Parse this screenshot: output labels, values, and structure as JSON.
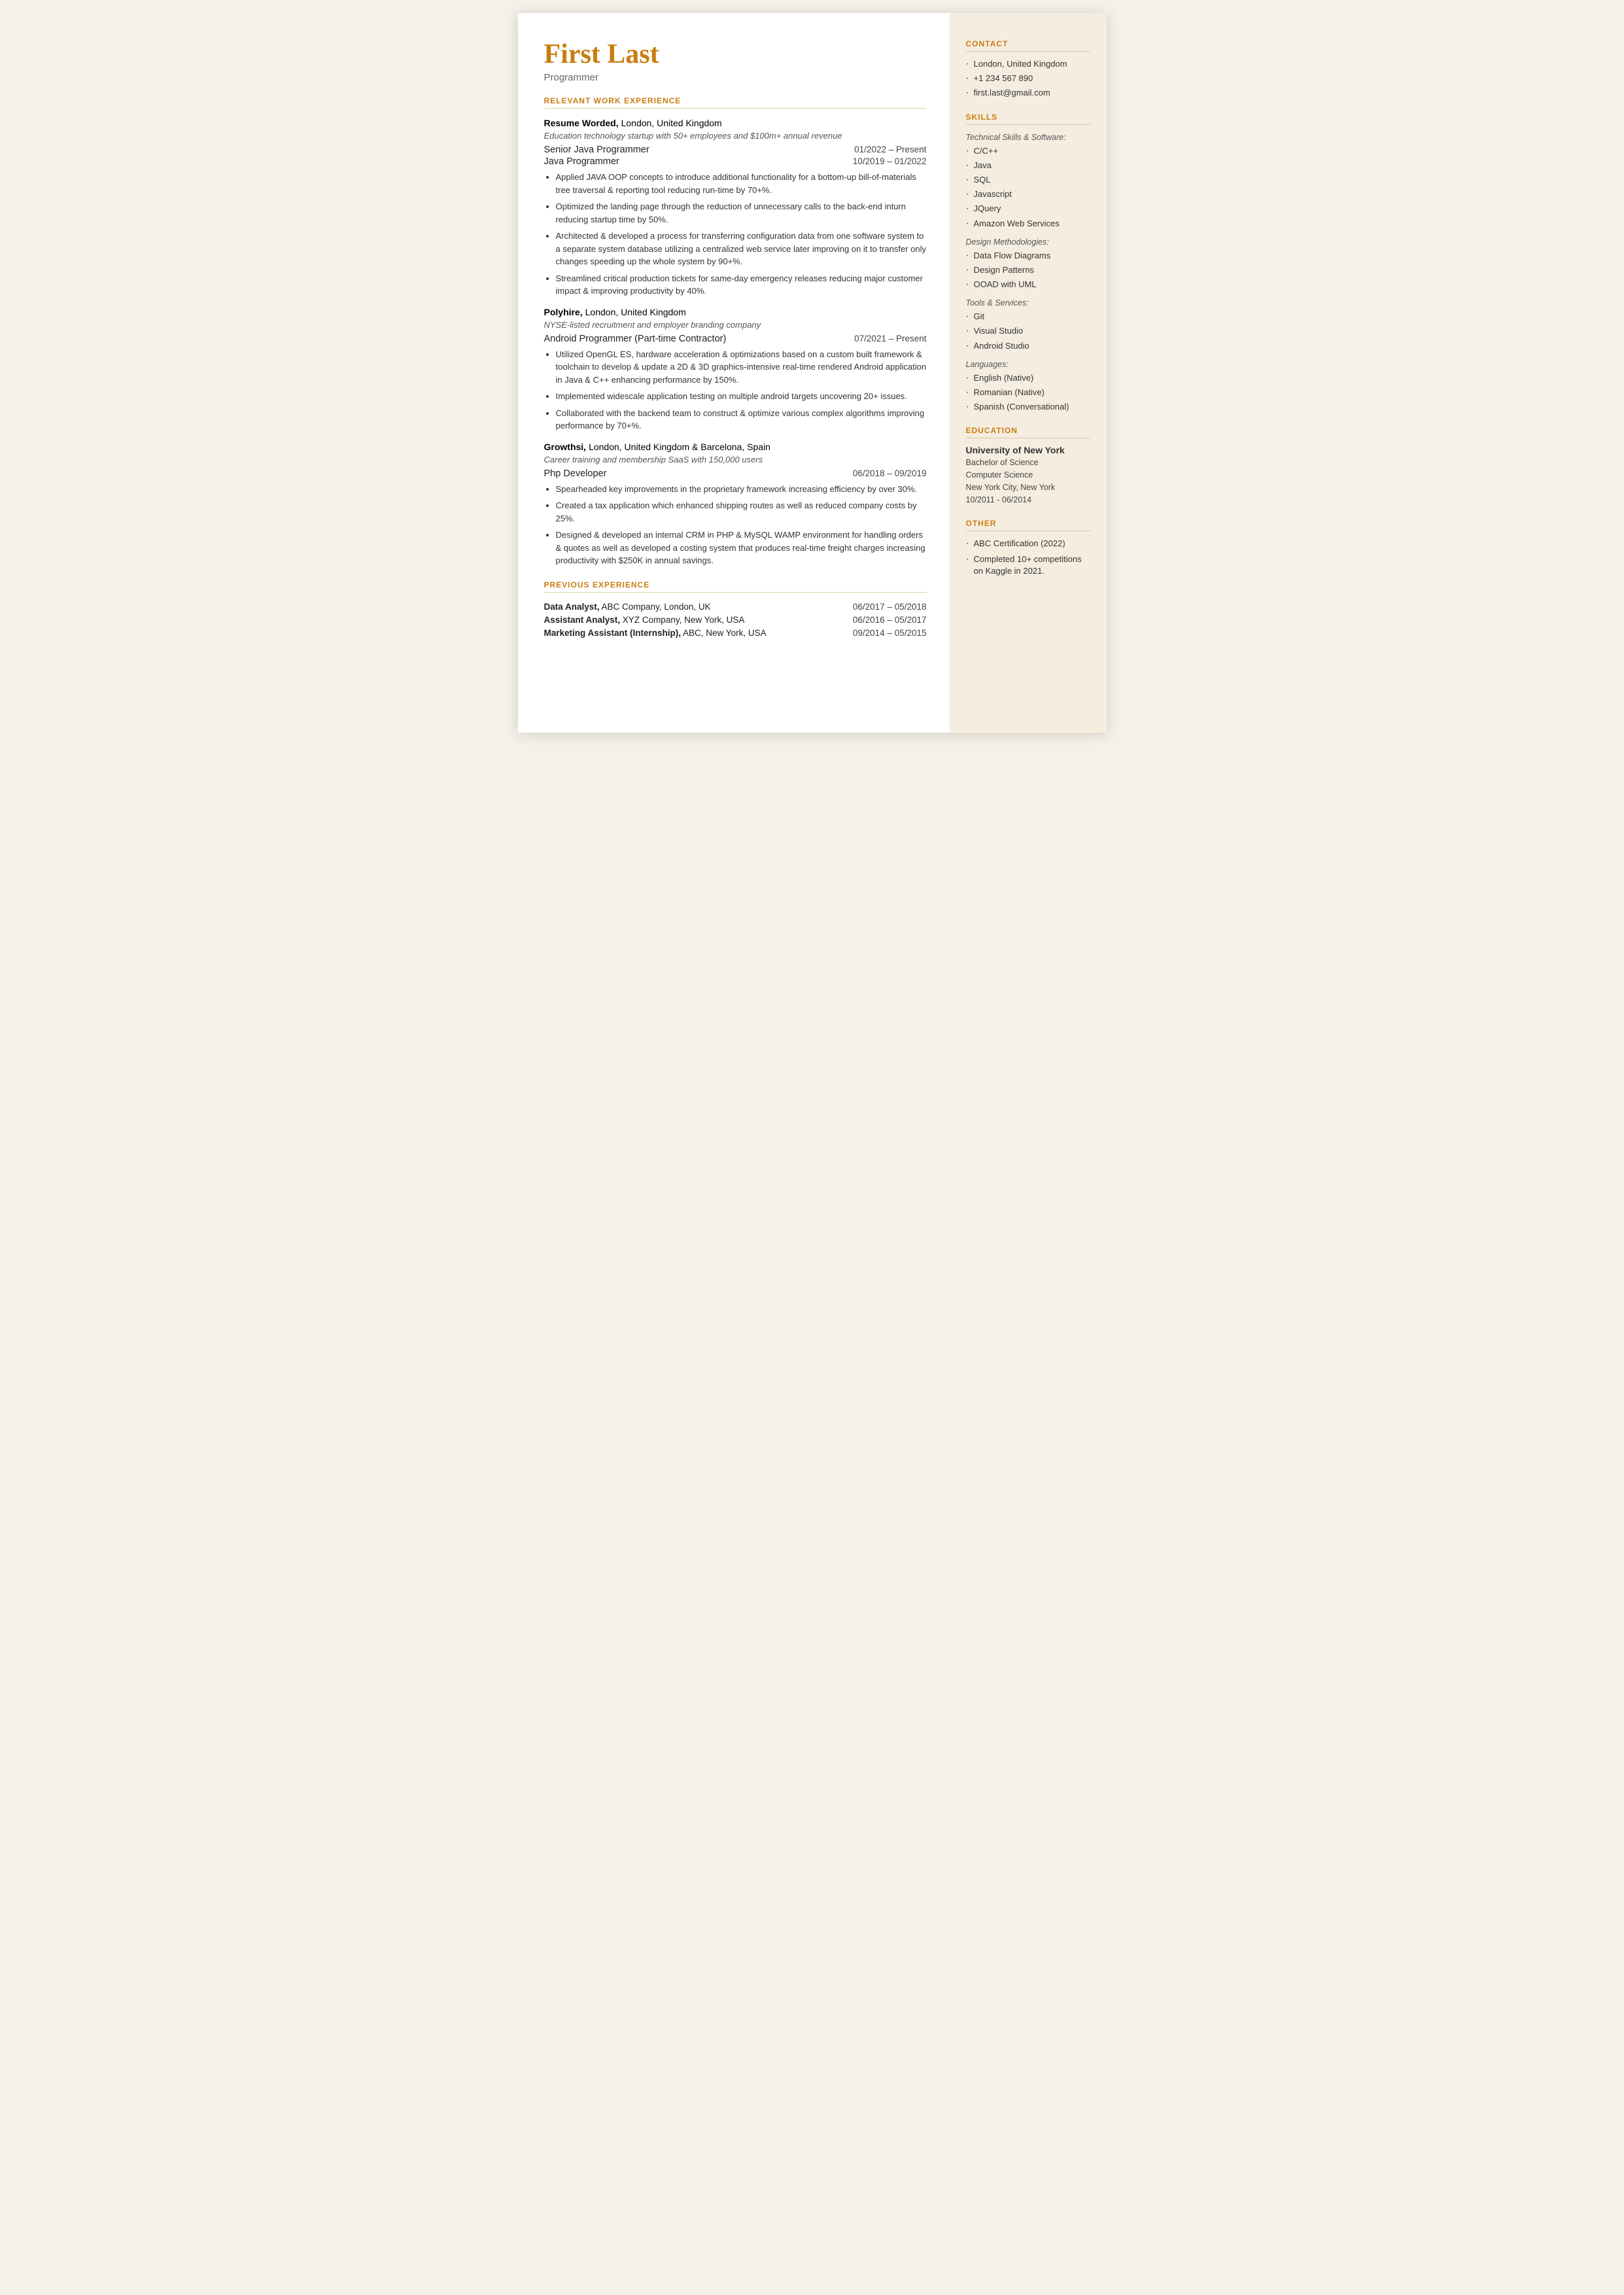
{
  "header": {
    "name": "First Last",
    "title": "Programmer"
  },
  "sections": {
    "relevant_work": {
      "label": "RELEVANT WORK EXPERIENCE",
      "jobs": [
        {
          "company": "Resume Worded,",
          "location": " London, United Kingdom",
          "description": "Education technology startup with 50+ employees and $100m+ annual revenue",
          "roles": [
            {
              "title": "Senior Java Programmer",
              "dates": "01/2022 – Present"
            },
            {
              "title": "Java Programmer",
              "dates": "10/2019 – 01/2022"
            }
          ],
          "bullets": [
            "Applied JAVA OOP concepts to introduce additional functionality for a bottom-up bill-of-materials tree traversal & reporting tool reducing run-time by 70+%.",
            "Optimized the landing page through the reduction of unnecessary calls to the back-end inturn reducing startup time by 50%.",
            "Architected & developed a process for transferring configuration data from one software system to a separate system database utilizing a centralized web service later improving on it to transfer only changes speeding up the whole system by 90+%.",
            "Streamlined critical production tickets for same-day emergency releases reducing major customer impact & improving productivity by 40%."
          ]
        },
        {
          "company": "Polyhire,",
          "location": " London, United Kingdom",
          "description": "NYSE-listed recruitment and employer branding company",
          "roles": [
            {
              "title": "Android Programmer (Part-time Contractor)",
              "dates": "07/2021 – Present"
            }
          ],
          "bullets": [
            "Utilized OpenGL ES, hardware acceleration & optimizations based on a custom built framework & toolchain to develop & update a 2D & 3D graphics-intensive real-time rendered Android application in Java & C++ enhancing performance by 150%.",
            "Implemented widescale application testing on multiple android targets uncovering 20+ issues.",
            "Collaborated with the backend team to construct & optimize various complex algorithms improving performance by 70+%."
          ]
        },
        {
          "company": "Growthsi,",
          "location": " London, United Kingdom & Barcelona, Spain",
          "description": "Career training and membership SaaS with 150,000 users",
          "roles": [
            {
              "title": "Php Developer",
              "dates": "06/2018 – 09/2019"
            }
          ],
          "bullets": [
            "Spearheaded key improvements in the proprietary framework increasing efficiency by over 30%.",
            "Created a tax application which enhanced shipping routes as well as reduced company costs by 25%.",
            "Designed & developed an internal CRM in PHP & MySQL WAMP environment for handling orders & quotes as well as developed a costing system that produces real-time freight charges increasing productivity with $250K in annual savings."
          ]
        }
      ]
    },
    "previous_experience": {
      "label": "PREVIOUS EXPERIENCE",
      "entries": [
        {
          "left": "<strong>Data Analyst,</strong> ABC Company, London, UK",
          "dates": "06/2017 – 05/2018"
        },
        {
          "left": "<strong>Assistant Analyst,</strong> XYZ Company, New York, USA",
          "dates": "06/2016 – 05/2017"
        },
        {
          "left": "<strong>Marketing Assistant (Internship),</strong> ABC, New York, USA",
          "dates": "09/2014 – 05/2015"
        }
      ]
    }
  },
  "sidebar": {
    "contact": {
      "label": "CONTACT",
      "items": [
        "London, United Kingdom",
        "+1 234 567 890",
        "first.last@gmail.com"
      ]
    },
    "skills": {
      "label": "SKILLS",
      "categories": [
        {
          "name": "Technical Skills & Software:",
          "items": [
            "C/C++",
            "Java",
            "SQL",
            "Javascript",
            "JQuery",
            "Amazon Web Services"
          ]
        },
        {
          "name": "Design Methodologies:",
          "items": [
            "Data Flow Diagrams",
            "Design Patterns",
            "OOAD with UML"
          ]
        },
        {
          "name": "Tools & Services:",
          "items": [
            "Git",
            "Visual Studio",
            "Android Studio"
          ]
        },
        {
          "name": "Languages:",
          "items": [
            "English (Native)",
            "Romanian (Native)",
            "Spanish (Conversational)"
          ]
        }
      ]
    },
    "education": {
      "label": "EDUCATION",
      "school": "University of New York",
      "degree": "Bachelor of Science",
      "field": "Computer Science",
      "location": "New York City, New York",
      "dates": "10/2011 - 06/2014"
    },
    "other": {
      "label": "OTHER",
      "items": [
        "ABC Certification (2022)",
        "Completed 10+ competitions on Kaggle in 2021."
      ]
    }
  }
}
